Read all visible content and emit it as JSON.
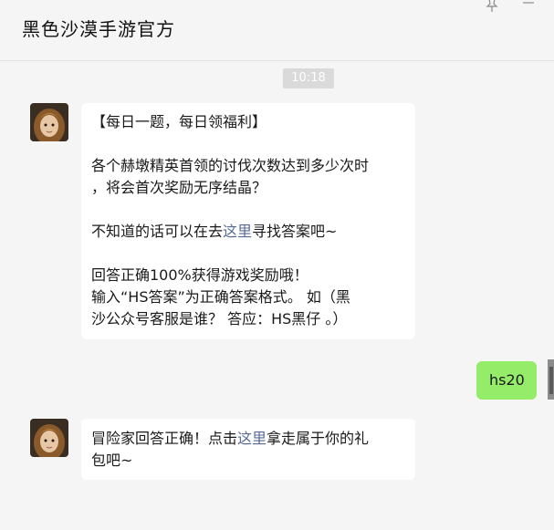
{
  "header": {
    "title": "黑色沙漠手游官方"
  },
  "icons": {
    "pin": "pin-icon",
    "minimize": "minimize-icon"
  },
  "timestamp": "10:18",
  "messages": {
    "m1": {
      "l1": "【每日一题，每日领福利】",
      "l2": "各个赫墩精英首领的讨伐次数达到多少次时",
      "l3": "，将会首次奖励无序结晶？",
      "l4_pre": "不知道的话可以在去",
      "l4_link": "这里",
      "l4_post": "寻找答案吧~",
      "l5": "回答正确100%获得游戏奖励哦！",
      "l6": "输入“HS答案”为正确答案格式。 如（黑",
      "l7": "沙公众号客服是谁？ 答应：HS黑仔 。）"
    },
    "m2": {
      "text": "hs20"
    },
    "m3": {
      "l1_pre": "冒险家回答正确！点击",
      "l1_link": "这里",
      "l1_post": "拿走属于你的礼",
      "l2": "包吧~"
    }
  },
  "colors": {
    "background": "#f5f5f5",
    "self_bubble": "#95ec69",
    "other_bubble": "#ffffff",
    "link": "#576b95"
  }
}
